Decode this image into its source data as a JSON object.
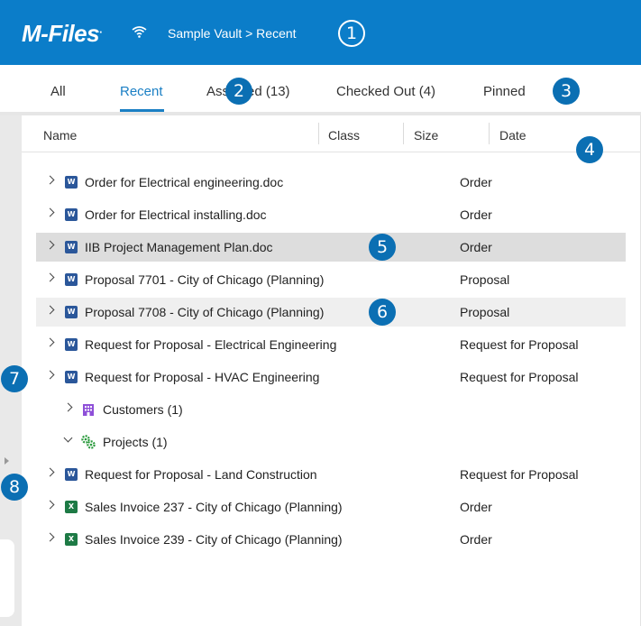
{
  "header": {
    "logo": "M-Files",
    "logo_mark": ".",
    "breadcrumb": "Sample Vault > Recent"
  },
  "tabs": [
    {
      "label": "All"
    },
    {
      "label": "Recent"
    },
    {
      "label": "Assigned (13)"
    },
    {
      "label": "Checked Out (4)"
    },
    {
      "label": "Pinned"
    }
  ],
  "columns": {
    "name": "Name",
    "class": "Class",
    "size": "Size",
    "date": "Date"
  },
  "rows": [
    {
      "name": "Order for Electrical engineering.doc",
      "class": "Order",
      "icon": "word-icon"
    },
    {
      "name": "Order for Electrical installing.doc",
      "class": "Order",
      "icon": "word-icon"
    },
    {
      "name": "IIB Project Management Plan.doc",
      "class": "Order",
      "icon": "word-icon"
    },
    {
      "name": "Proposal 7701 - City of Chicago (Planning)",
      "class": "Proposal",
      "icon": "word-icon"
    },
    {
      "name": "Proposal 7708 - City of Chicago (Planning)",
      "class": "Proposal",
      "icon": "word-icon"
    },
    {
      "name": "Request for Proposal - Electrical Engineering",
      "class": "Request for Proposal",
      "icon": "word-icon"
    },
    {
      "name": "Request for Proposal - HVAC Engineering",
      "class": "Request for Proposal",
      "icon": "word-icon"
    },
    {
      "name": "Customers (1)",
      "class": "",
      "icon": "building-icon"
    },
    {
      "name": "Projects (1)",
      "class": "",
      "icon": "gears-icon"
    },
    {
      "name": "Request for Proposal - Land Construction",
      "class": "Request for Proposal",
      "icon": "word-icon"
    },
    {
      "name": "Sales Invoice 237 - City of Chicago (Planning)",
      "class": "Order",
      "icon": "excel-icon"
    },
    {
      "name": "Sales Invoice 239 - City of Chicago (Planning)",
      "class": "Order",
      "icon": "excel-icon"
    }
  ],
  "icon_letters": {
    "word": "W",
    "excel": "X"
  },
  "callouts": [
    "1",
    "2",
    "3",
    "4",
    "5",
    "6",
    "7",
    "8"
  ],
  "colors": {
    "brand": "#0b7dc9",
    "accent": "#1a7fc4",
    "selected_row": "#dddddd"
  }
}
